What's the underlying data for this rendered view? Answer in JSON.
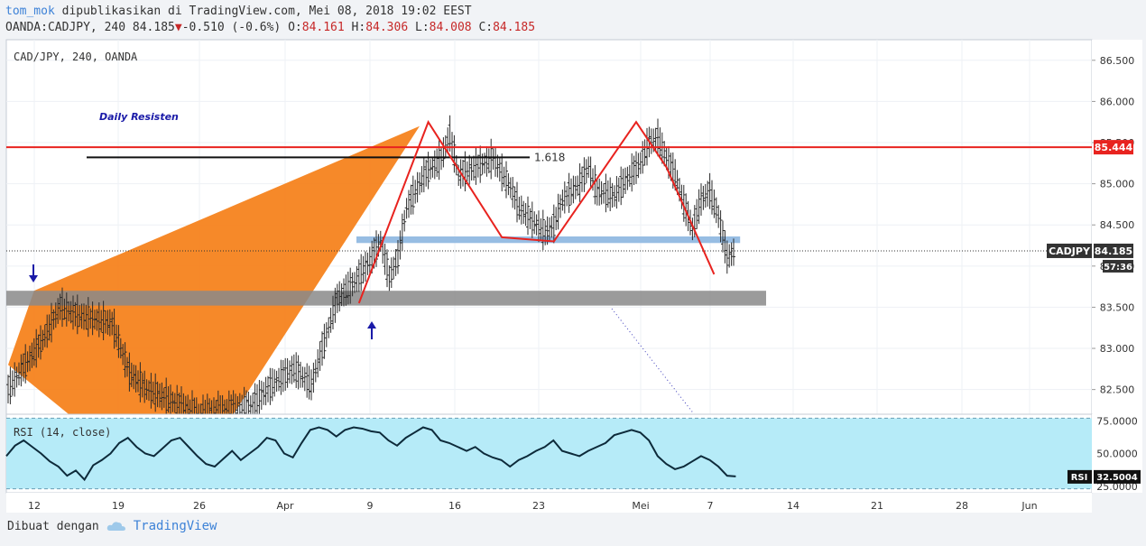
{
  "header": {
    "author": "tom_mok",
    "published": "dipublikasikan di TradingView.com, Mei 08, 2018 19:02 EEST",
    "symbol": "OANDA:CADJPY, 240",
    "last": "84.185",
    "change": "-0.510 (-0.6%)",
    "o_label": "O:",
    "o_val": "84.161",
    "h_label": "H:",
    "h_val": "84.306",
    "l_label": "L:",
    "l_val": "84.008",
    "c_label": "C:",
    "c_val": "84.185"
  },
  "chart_data": [
    {
      "type": "line",
      "title": "CAD/JPY, 240, OANDA",
      "x_ticks": [
        "12",
        "19",
        "26",
        "Apr",
        "9",
        "16",
        "23",
        "Mei",
        "7",
        "14",
        "21",
        "28",
        "Jun"
      ],
      "ylim": [
        82.2,
        86.75
      ],
      "y_ticks": [
        "86.500",
        "86.000",
        "85.500",
        "85.000",
        "84.500",
        "84.000",
        "83.500",
        "83.000",
        "82.500"
      ],
      "grid": true,
      "price_path": [
        [
          0,
          82.5
        ],
        [
          4,
          83.1
        ],
        [
          6,
          83.5
        ],
        [
          8,
          83.4
        ],
        [
          12,
          83.3
        ],
        [
          14,
          82.7
        ],
        [
          16,
          82.5
        ],
        [
          19,
          82.35
        ],
        [
          22,
          82.2
        ],
        [
          25,
          82.25
        ],
        [
          28,
          82.3
        ],
        [
          31,
          82.6
        ],
        [
          33,
          82.75
        ],
        [
          35,
          82.55
        ],
        [
          36,
          82.9
        ],
        [
          38,
          83.6
        ],
        [
          40,
          83.8
        ],
        [
          42,
          84.1
        ],
        [
          43,
          84.3
        ],
        [
          44,
          83.85
        ],
        [
          45,
          84.1
        ],
        [
          46,
          84.7
        ],
        [
          48,
          85.1
        ],
        [
          50,
          85.3
        ],
        [
          51,
          85.6
        ],
        [
          52,
          85.1
        ],
        [
          54,
          85.2
        ],
        [
          56,
          85.3
        ],
        [
          58,
          84.95
        ],
        [
          59,
          84.7
        ],
        [
          61,
          84.5
        ],
        [
          62,
          84.4
        ],
        [
          63,
          84.5
        ],
        [
          64,
          84.8
        ],
        [
          66,
          85.0
        ],
        [
          67,
          85.2
        ],
        [
          68,
          84.9
        ],
        [
          70,
          84.85
        ],
        [
          71,
          85.0
        ],
        [
          73,
          85.25
        ],
        [
          74,
          85.5
        ],
        [
          75,
          85.55
        ],
        [
          76,
          85.3
        ],
        [
          77,
          85.1
        ],
        [
          78,
          84.75
        ],
        [
          79,
          84.45
        ],
        [
          80,
          84.8
        ],
        [
          81,
          84.9
        ],
        [
          82,
          84.6
        ],
        [
          83,
          84.1
        ],
        [
          84,
          84.185
        ]
      ],
      "annotations": {
        "daily_resist_label": "Daily Resisten",
        "fib_label": "1.618",
        "resistance_level": "85.444",
        "last_label": "CADJPY",
        "last_value": "84.185",
        "countdown": "57:36"
      },
      "double_top_path": [
        [
          40.5,
          83.55
        ],
        [
          48.5,
          85.75
        ],
        [
          57,
          84.35
        ],
        [
          63,
          84.3
        ],
        [
          72.5,
          85.75
        ],
        [
          76,
          85.2
        ],
        [
          81.5,
          83.9
        ]
      ],
      "harmonic_fill": [
        [
          0,
          82.8
        ],
        [
          3,
          83.7
        ],
        [
          47.5,
          85.7
        ],
        [
          26,
          82.2
        ],
        [
          7,
          82.2
        ]
      ],
      "zones": [
        {
          "from": 83.52,
          "to": 83.7,
          "x_end": 87.5
        },
        {
          "from": 84.28,
          "to": 84.36,
          "x_end": 84.5
        }
      ]
    },
    {
      "type": "line",
      "title": "RSI (14, close)",
      "ylim": [
        20,
        80
      ],
      "y_ticks": [
        "75.0000",
        "50.0000",
        "25.0000"
      ],
      "last_label": "RSI",
      "last_value": "32.5004",
      "values": [
        48,
        56,
        60,
        55,
        50,
        44,
        40,
        33,
        37,
        30,
        41,
        45,
        50,
        58,
        62,
        55,
        50,
        48,
        54,
        60,
        62,
        55,
        48,
        42,
        40,
        46,
        52,
        45,
        50,
        55,
        62,
        60,
        50,
        47,
        58,
        68,
        70,
        68,
        63,
        68,
        70,
        69,
        67,
        66,
        60,
        56,
        62,
        66,
        70,
        68,
        60,
        58,
        55,
        52,
        55,
        50,
        47,
        45,
        40,
        45,
        48,
        52,
        55,
        60,
        52,
        50,
        48,
        52,
        55,
        58,
        64,
        66,
        68,
        66,
        60,
        48,
        42,
        38,
        40,
        44,
        48,
        45,
        40,
        33,
        32.5
      ]
    }
  ],
  "footer": {
    "made_with": "Dibuat dengan",
    "brand": "TradingView"
  }
}
